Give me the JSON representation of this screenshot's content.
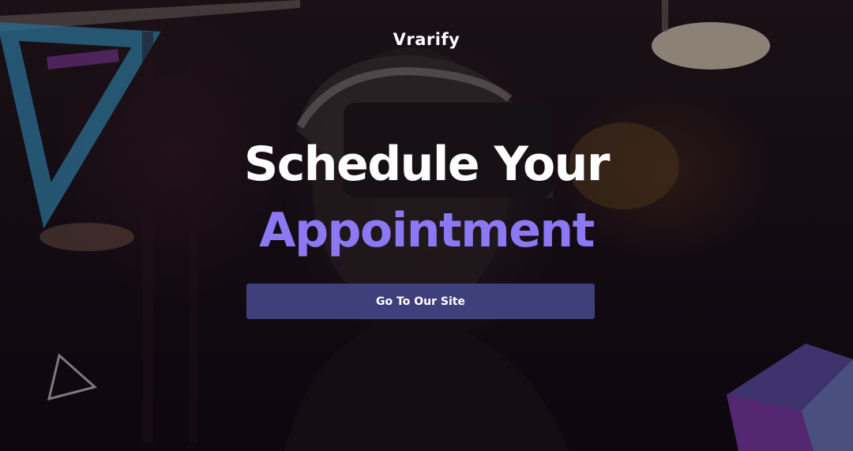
{
  "brand": {
    "name": "Vrarify"
  },
  "hero": {
    "heading_line1": "Schedule Your",
    "heading_line2": "Appointment",
    "cta_label": "Go To Our Site"
  },
  "colors": {
    "accent": "#8b78f2",
    "button": "#3f3f7c",
    "background": "#140b12"
  },
  "icons": [
    "triangle-outline-icon",
    "triangle-neon-shape",
    "cube-shape"
  ]
}
